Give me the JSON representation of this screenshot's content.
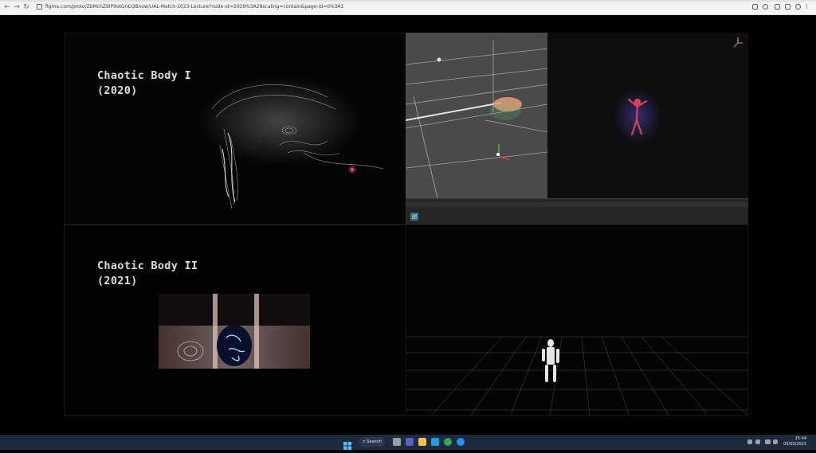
{
  "browser": {
    "url": "figma.com/proto/ZbMchZ9lP9otGnCQBnow/UAL-Match-2023-Lecture?node-id=2029%3A28scaling=contain&page-id=0%3A1",
    "nav": {
      "back": "←",
      "forward": "→",
      "reload": "↻"
    }
  },
  "slides": {
    "panel1": {
      "title_line1": "Chaotic Body I",
      "title_line2": "(2020)"
    },
    "panel3": {
      "title_line1": "Chaotic Body II",
      "title_line2": "(2021)"
    }
  },
  "taskbar": {
    "search_label": "Search",
    "time": "15:44",
    "date": "05/03/2023"
  }
}
